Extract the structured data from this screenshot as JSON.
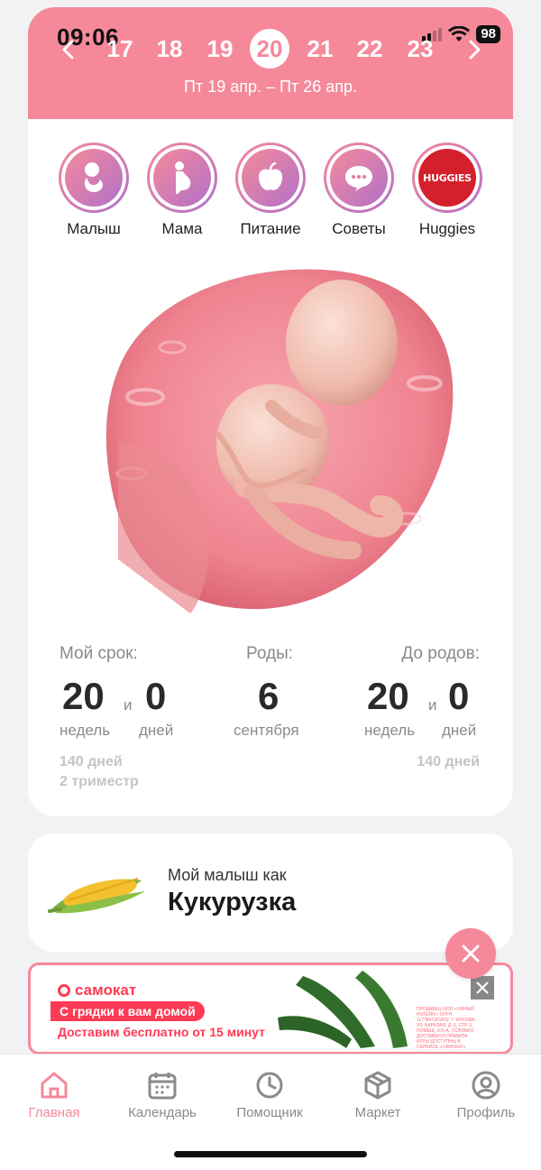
{
  "status": {
    "time": "09:06",
    "battery": "98"
  },
  "calendar": {
    "days": [
      "17",
      "18",
      "19",
      "20",
      "21",
      "22",
      "23"
    ],
    "selected": "20",
    "range": "Пт 19 апр. – Пт 26 апр."
  },
  "categories": [
    {
      "label": "Малыш",
      "icon": "baby-icon"
    },
    {
      "label": "Мама",
      "icon": "pregnant-woman-icon"
    },
    {
      "label": "Питание",
      "icon": "apple-icon"
    },
    {
      "label": "Советы",
      "icon": "chat-bubble-icon"
    },
    {
      "label": "Huggies",
      "icon": "huggies-logo",
      "logo_text": "HUGGIES"
    }
  ],
  "stats": {
    "term": {
      "label": "Мой срок:",
      "weeks": "20",
      "and": "и",
      "days": "0",
      "weeks_unit": "недель",
      "days_unit": "дней",
      "total_days": "140 дней",
      "trimester": "2 триместр"
    },
    "birth": {
      "label": "Роды:",
      "day": "6",
      "month": "сентября"
    },
    "remaining": {
      "label": "До родов:",
      "weeks": "20",
      "and": "и",
      "days": "0",
      "weeks_unit": "недель",
      "days_unit": "дней",
      "total_days": "140 дней"
    }
  },
  "baby_size": {
    "prefix": "Мой малыш как",
    "fruit": "Кукурузка"
  },
  "ad": {
    "brand": "самокат",
    "slogan": "С грядки к вам домой",
    "subline": "Доставим бесплатно от 15 минут",
    "fine_print": "ПРОДАВЕЦ ООО «УМНЫЙ РИТЕЙЛ», ОГРН 1177847261602, Г. МОСКВА, УЛ. БАРКЛАЯ, Д. 6, СТР. 3. ПОМЕЩ. 104-А. УСЛОВИЯ ДОСТАВКИ И ПРАВИЛА ИГРЫ ДОСТУПНЫ В СЕРВИСЕ «САМОКАТ»"
  },
  "tabs": [
    {
      "label": "Главная",
      "icon": "home-icon",
      "active": true
    },
    {
      "label": "Календарь",
      "icon": "calendar-icon",
      "active": false
    },
    {
      "label": "Помощник",
      "icon": "clock-icon",
      "active": false
    },
    {
      "label": "Маркет",
      "icon": "box-icon",
      "active": false
    },
    {
      "label": "Профиль",
      "icon": "profile-icon",
      "active": false
    }
  ],
  "colors": {
    "accent": "#f5899a",
    "gradient_end": "#b271c9",
    "ad_red": "#ff3a54"
  }
}
